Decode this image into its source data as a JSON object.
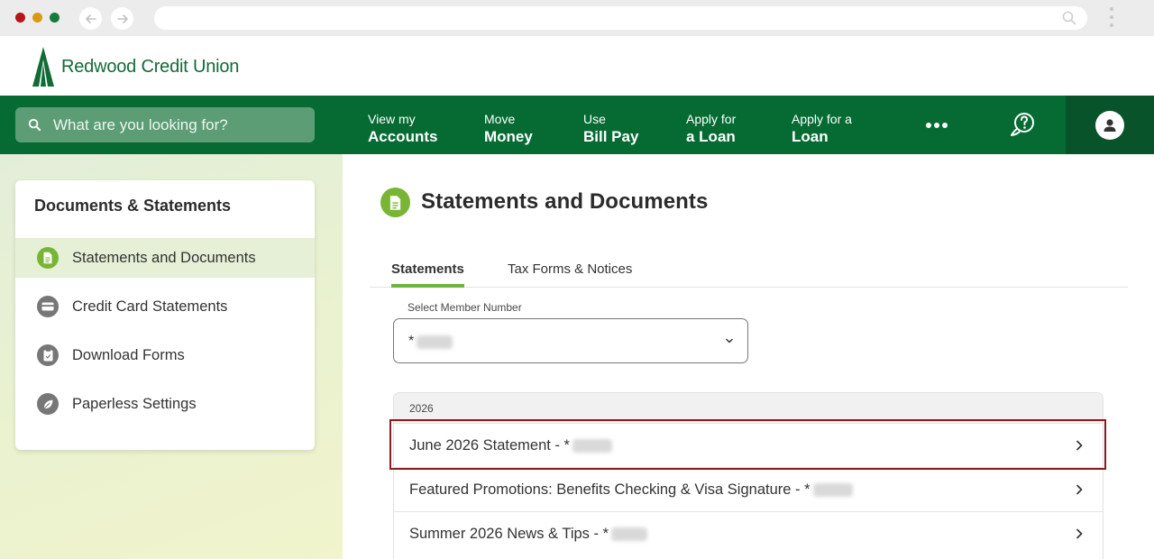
{
  "browser": {
    "back_icon": "arrow-left-icon",
    "forward_icon": "arrow-right-icon",
    "search_icon": "magnifier-icon",
    "menu_icon": "kebab-icon"
  },
  "brand": {
    "name": "Redwood Credit Union",
    "color_primary": "#056b33",
    "color_accent": "#6db33f"
  },
  "topnav": {
    "search_placeholder": "What are you looking for?",
    "items": [
      {
        "line1": "View my",
        "line2": "Accounts"
      },
      {
        "line1": "Move",
        "line2": "Money"
      },
      {
        "line1": "Use",
        "line2": "Bill Pay"
      },
      {
        "line1": "Apply for",
        "line2": "a Loan"
      },
      {
        "line1": "Apply for a",
        "line2": "Loan"
      }
    ]
  },
  "sidebar": {
    "title": "Documents & Statements",
    "items": [
      {
        "label": "Statements and Documents",
        "icon": "document-icon",
        "active": true
      },
      {
        "label": "Credit Card Statements",
        "icon": "credit-card-icon",
        "active": false
      },
      {
        "label": "Download Forms",
        "icon": "clipboard-icon",
        "active": false
      },
      {
        "label": "Paperless Settings",
        "icon": "leaf-icon",
        "active": false
      }
    ]
  },
  "main": {
    "title": "Statements and Documents",
    "tabs": [
      {
        "label": "Statements",
        "active": true
      },
      {
        "label": "Tax Forms & Notices",
        "active": false
      }
    ],
    "member_select": {
      "label": "Select Member Number",
      "value": "*"
    },
    "year": "2026",
    "rows": [
      {
        "label": "June 2026 Statement - *",
        "highlighted": true
      },
      {
        "label": "Featured Promotions: Benefits Checking & Visa Signature - *",
        "highlighted": false
      },
      {
        "label": "Summer 2026 News & Tips - *",
        "highlighted": false
      }
    ]
  }
}
